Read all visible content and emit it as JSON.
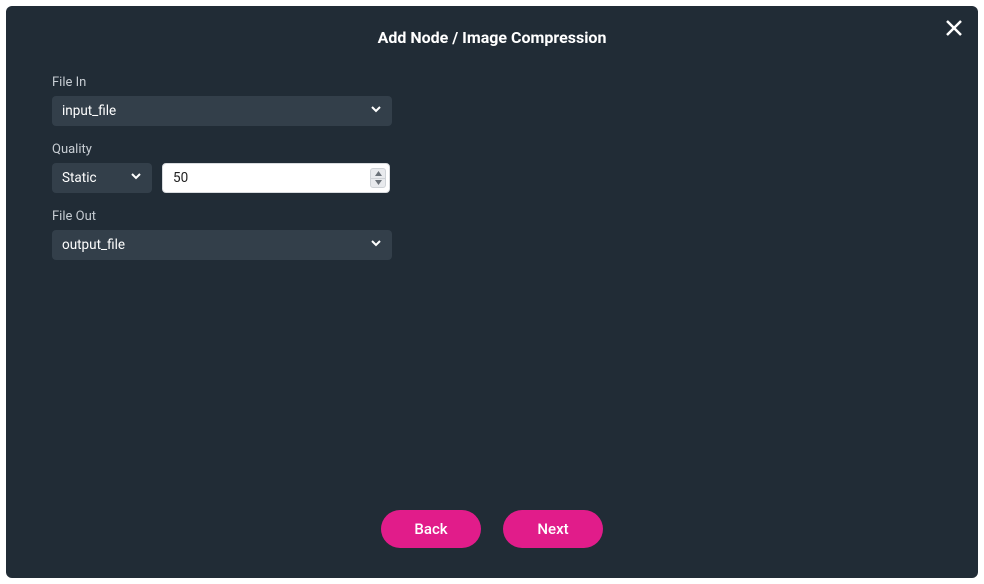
{
  "modal": {
    "title": "Add Node / Image Compression"
  },
  "fields": {
    "file_in": {
      "label": "File In",
      "value": "input_file"
    },
    "quality": {
      "label": "Quality",
      "mode": "Static",
      "value": "50"
    },
    "file_out": {
      "label": "File Out",
      "value": "output_file"
    }
  },
  "footer": {
    "back_label": "Back",
    "next_label": "Next"
  }
}
